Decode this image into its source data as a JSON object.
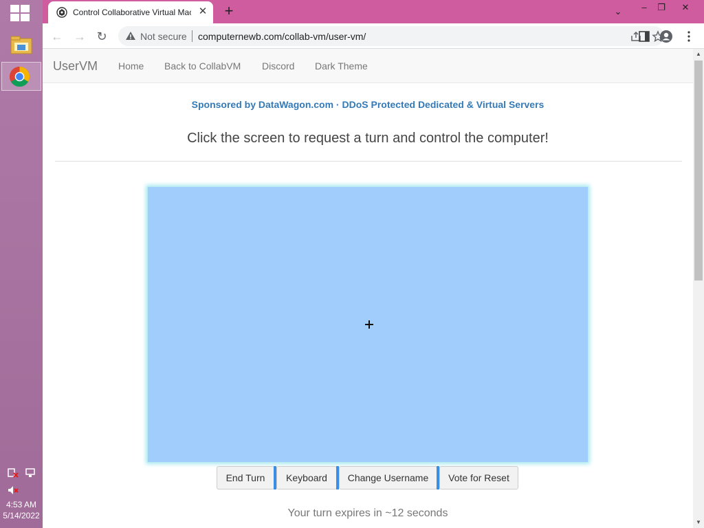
{
  "taskbar": {
    "clock_time": "4:53 AM",
    "clock_date": "5/14/2022",
    "icons": [
      "windows-start-icon",
      "file-explorer-icon",
      "chrome-icon",
      "network-error-icon",
      "network-icon",
      "volume-muted-icon"
    ]
  },
  "browser": {
    "tab_title": "Control Collaborative Virtual Machine",
    "tab_close": "✕",
    "new_tab": "+",
    "window_controls": {
      "tab_search": "⌄",
      "minimize": "–",
      "restore": "❐",
      "close": "✕"
    },
    "security_label": "Not secure",
    "url": "computernewb.com/collab-vm/user-vm/",
    "nav": {
      "back": "←",
      "forward": "→",
      "reload": "↻"
    }
  },
  "page": {
    "brand": "UserVM",
    "nav_links": [
      "Home",
      "Back to CollabVM",
      "Discord",
      "Dark Theme"
    ],
    "sponsor": "Sponsored by DataWagon.com · DDoS Protected Dedicated & Virtual Servers",
    "headline": "Click the screen to request a turn and control the computer!",
    "buttons": [
      "End Turn",
      "Keyboard",
      "Change Username",
      "Vote for Reset"
    ],
    "turn_status": "Your turn expires in ~12 seconds",
    "vm_screen_color": "#a0cdfc"
  },
  "colors": {
    "titlebar": "#cf5c9e",
    "accent_link": "#337ab7",
    "button_separator": "#3b8ee4"
  }
}
